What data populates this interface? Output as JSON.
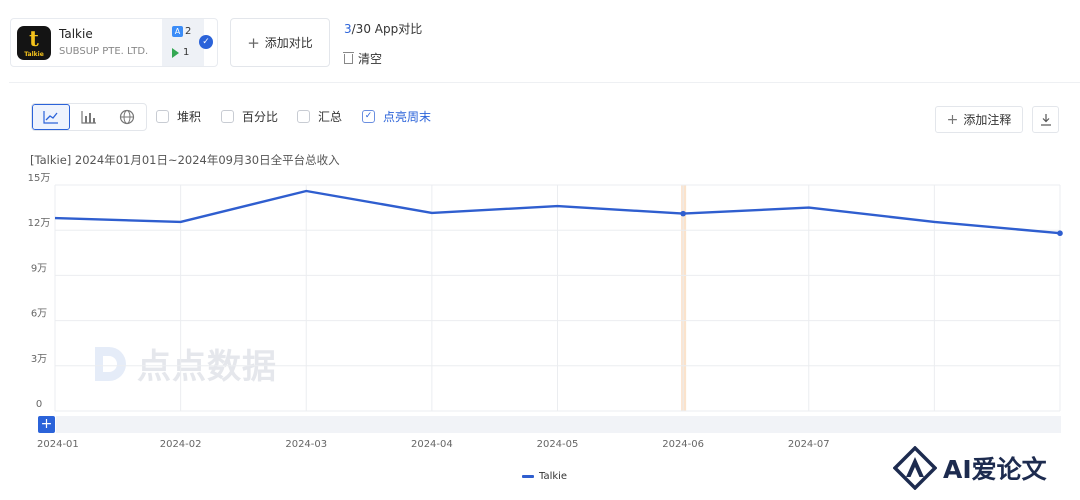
{
  "app_card": {
    "name": "Talkie",
    "publisher": "SUBSUP PTE. LTD.",
    "logo_text": "Talkie",
    "ios_count": "2",
    "gp_count": "1"
  },
  "compare": {
    "add_label": "添加对比",
    "current": "3",
    "suffix": "/30 App对比",
    "clear_label": "清空"
  },
  "toolbar": {
    "options": [
      {
        "label": "堆积",
        "checked": false
      },
      {
        "label": "百分比",
        "checked": false
      },
      {
        "label": "汇总",
        "checked": false
      },
      {
        "label": "点亮周末",
        "checked": true
      }
    ],
    "add_note_label": "添加注释"
  },
  "chart_title": "[Talkie] 2024年01月01日~2024年09月30日全平台总收入",
  "watermark": "点点数据",
  "brand": "AI爱论文",
  "colors": {
    "accent": "#2b63d9",
    "line": "#2f5ecf",
    "highlight": "#fbe3cc"
  },
  "chart_data": {
    "type": "line",
    "title": "[Talkie] 2024年01月01日~2024年09月30日全平台总收入",
    "ylim": [
      0,
      150000
    ],
    "y_ticks": [
      {
        "value": 150000,
        "label": "15万"
      },
      {
        "value": 120000,
        "label": "12万"
      },
      {
        "value": 90000,
        "label": "9万"
      },
      {
        "value": 60000,
        "label": "6万"
      },
      {
        "value": 30000,
        "label": "3万"
      },
      {
        "value": 0,
        "label": "0"
      }
    ],
    "x_ticks": [
      "2024-01",
      "2024-02",
      "2024-03",
      "2024-04",
      "2024-05",
      "2024-06",
      "2024-07"
    ],
    "grid": true,
    "legend_position": "bottom",
    "highlight_x": "2024-06",
    "series": [
      {
        "name": "Talkie",
        "points": [
          {
            "x": "2024-01",
            "y": 128000
          },
          {
            "x": "2024-02",
            "y": 125500
          },
          {
            "x": "2024-03",
            "y": 146000
          },
          {
            "x": "2024-04",
            "y": 131500
          },
          {
            "x": "2024-05",
            "y": 136000
          },
          {
            "x": "2024-06",
            "y": 131000
          },
          {
            "x": "2024-07",
            "y": 135000
          },
          {
            "x": "2024-08",
            "y": 125500
          },
          {
            "x": "2024-09",
            "y": 118000
          }
        ],
        "marked_points": [
          "2024-06",
          "2024-09"
        ]
      }
    ]
  }
}
